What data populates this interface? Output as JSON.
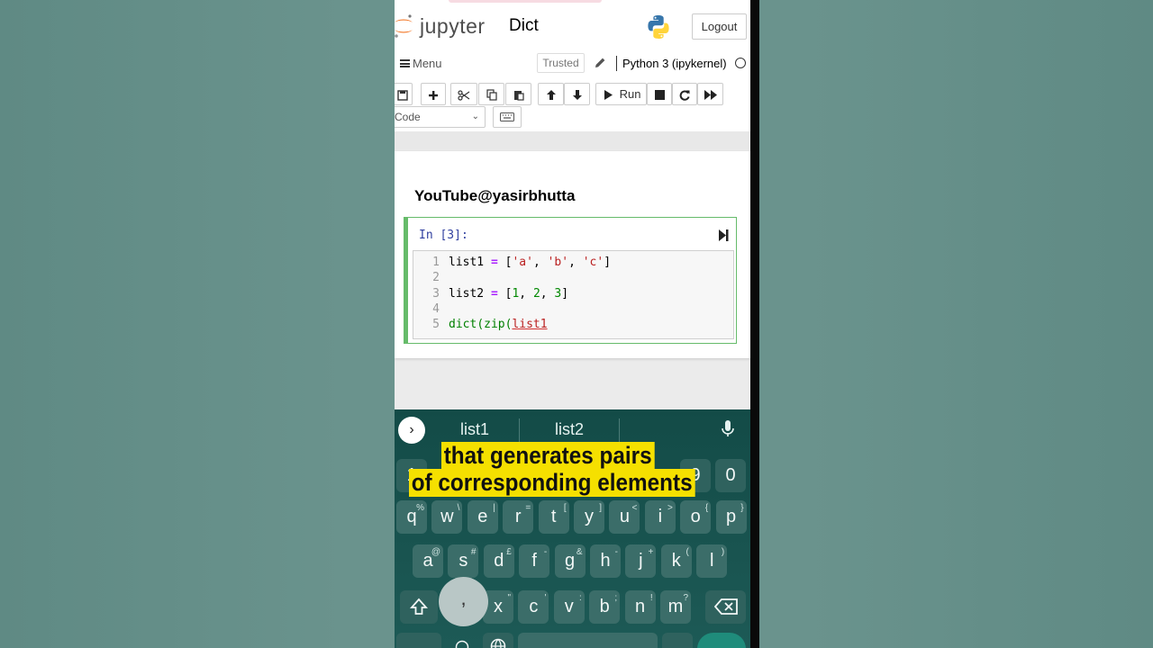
{
  "header": {
    "logo_text": "jupyter",
    "notebook_title": "Dict",
    "logout_label": "Logout"
  },
  "menubar": {
    "menu_label": "Menu",
    "trusted_label": "Trusted",
    "kernel_name": "Python 3 (ipykernel)"
  },
  "toolbar": {
    "run_label": "Run",
    "cell_type": "Code"
  },
  "notebook": {
    "heading": "YouTube@yasirbhutta",
    "cell": {
      "prompt": "In [3]:",
      "line_numbers": [
        "1",
        "2",
        "3",
        "4",
        "5"
      ],
      "lines": [
        "list1 = ['a', 'b', 'c']",
        "",
        "list2 = [1, 2, 3]",
        "",
        "dict(zip(list1"
      ]
    }
  },
  "keyboard": {
    "suggestions": [
      "list1",
      "list2"
    ],
    "number_row_visible": [
      "1",
      "9",
      "0"
    ],
    "row1": [
      {
        "k": "q",
        "s": "%"
      },
      {
        "k": "w",
        "s": "\\"
      },
      {
        "k": "e",
        "s": "|"
      },
      {
        "k": "r",
        "s": "="
      },
      {
        "k": "t",
        "s": "["
      },
      {
        "k": "y",
        "s": "]"
      },
      {
        "k": "u",
        "s": "<"
      },
      {
        "k": "i",
        "s": ">"
      },
      {
        "k": "o",
        "s": "{"
      },
      {
        "k": "p",
        "s": "}"
      }
    ],
    "row2": [
      {
        "k": "a",
        "s": "@"
      },
      {
        "k": "s",
        "s": "#"
      },
      {
        "k": "d",
        "s": "£"
      },
      {
        "k": "f",
        "s": "-"
      },
      {
        "k": "g",
        "s": "&"
      },
      {
        "k": "h",
        "s": "-"
      },
      {
        "k": "j",
        "s": "+"
      },
      {
        "k": "k",
        "s": "("
      },
      {
        "k": "l",
        "s": ")"
      }
    ],
    "row3": [
      {
        "k": "x",
        "s": "\""
      },
      {
        "k": "c",
        "s": "'"
      },
      {
        "k": "v",
        "s": ":"
      },
      {
        "k": "b",
        "s": ";"
      },
      {
        "k": "n",
        "s": "!"
      },
      {
        "k": "m",
        "s": "?"
      }
    ],
    "pressed_key": ","
  },
  "subtitles": {
    "line1": "that generates pairs",
    "line2": "of corresponding elements"
  },
  "colors": {
    "cell_border": "#66bb6a",
    "keyboard_bg": "#134b47",
    "subtitle_bg": "#f5e000",
    "background": "#6a938d"
  }
}
